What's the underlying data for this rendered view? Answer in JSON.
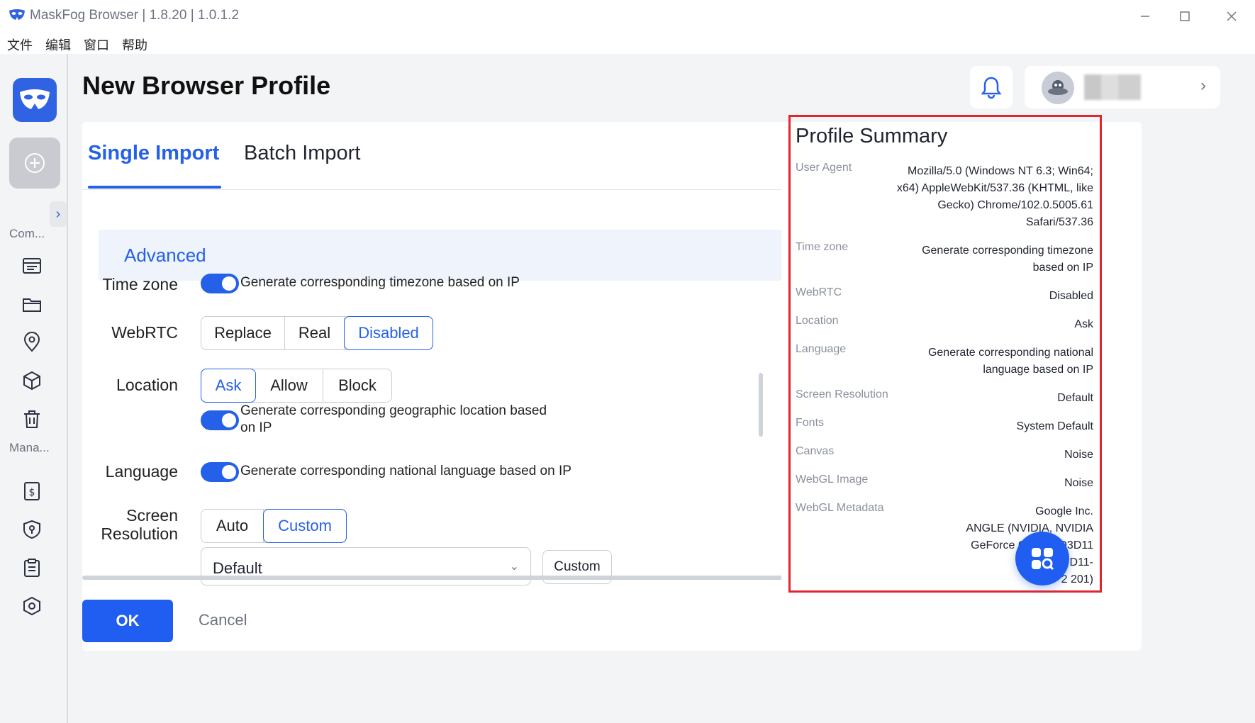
{
  "window": {
    "title": "MaskFog Browser | 1.8.20 | 1.0.1.2"
  },
  "menu": {
    "items": [
      "文件",
      "编辑",
      "窗口",
      "帮助"
    ]
  },
  "rail": {
    "section_common": "Com...",
    "section_manage": "Mana...",
    "icons": [
      "profile-list-icon",
      "folder-icon",
      "location-pin-icon",
      "package-icon",
      "trash-icon",
      "billing-icon",
      "shield-key-icon",
      "clipboard-icon",
      "settings-hex-icon"
    ]
  },
  "header": {
    "title": "New Browser Profile"
  },
  "tabs": [
    {
      "label": "Single Import",
      "active": true
    },
    {
      "label": "Batch Import",
      "active": false
    }
  ],
  "advanced": {
    "label": "Advanced"
  },
  "form": {
    "timezone": {
      "label": "Time zone",
      "toggle_text": "Generate corresponding timezone based on IP",
      "enabled": true
    },
    "webrtc": {
      "label": "WebRTC",
      "options": [
        "Replace",
        "Real",
        "Disabled"
      ],
      "selected": "Disabled"
    },
    "location": {
      "label": "Location",
      "options": [
        "Ask",
        "Allow",
        "Block"
      ],
      "selected": "Ask",
      "toggle_text_1": "Generate corresponding geographic location based",
      "toggle_text_2": "on IP",
      "enabled": true
    },
    "language": {
      "label": "Language",
      "toggle_text": "Generate corresponding national language based on IP",
      "enabled": true
    },
    "resolution": {
      "label_1": "Screen",
      "label_2": "Resolution",
      "options": [
        "Auto",
        "Custom"
      ],
      "selected": "Custom",
      "select_value": "Default",
      "custom_button": "Custom"
    }
  },
  "actions": {
    "ok": "OK",
    "cancel": "Cancel"
  },
  "summary": {
    "title": "Profile Summary",
    "rows": [
      {
        "key": "User Agent",
        "lines": [
          "Mozilla/5.0 (Windows NT 6.3; Win64;",
          "x64) AppleWebKit/537.36 (KHTML, like",
          "Gecko) Chrome/102.0.5005.61",
          "Safari/537.36"
        ]
      },
      {
        "key": "Time zone",
        "lines": [
          "Generate corresponding timezone",
          "based on IP"
        ]
      },
      {
        "key": "WebRTC",
        "lines": [
          "Disabled"
        ]
      },
      {
        "key": "Location",
        "lines": [
          "Ask"
        ]
      },
      {
        "key": "Language",
        "lines": [
          "Generate corresponding national",
          "language based on IP"
        ]
      },
      {
        "key": "Screen Resolution",
        "lines": [
          "Default"
        ]
      },
      {
        "key": "Fonts",
        "lines": [
          "System Default"
        ]
      },
      {
        "key": "Canvas",
        "lines": [
          "Noise"
        ]
      },
      {
        "key": "WebGL Image",
        "lines": [
          "Noise"
        ]
      },
      {
        "key": "WebGL Metadata",
        "lines": [
          "Google Inc.",
          "ANGLE (NVIDIA, NVIDIA",
          "GeForce GT 230 D3D11",
          "vs_4_1 p D11-",
          "2 201)"
        ]
      }
    ]
  },
  "colors": {
    "accent": "#2561e8",
    "highlight_border": "#e0262e"
  }
}
